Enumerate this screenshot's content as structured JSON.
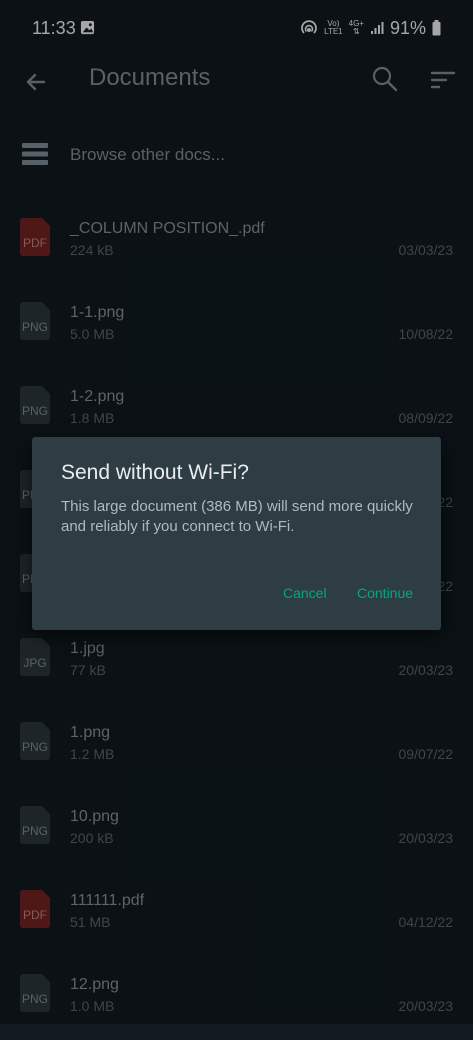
{
  "status_bar": {
    "time": "11:33",
    "network_volte": "Vo)",
    "network_lte": "LTE1",
    "network_4g": "4G+",
    "battery": "91%"
  },
  "app_bar": {
    "title": "Documents"
  },
  "browse": {
    "label": "Browse other docs..."
  },
  "files": [
    {
      "type_label": "PDF",
      "kind": "pdf",
      "name": "_COLUMN POSITION_.pdf",
      "size": "224 kB",
      "date": "03/03/23"
    },
    {
      "type_label": "PNG",
      "kind": "image",
      "name": "1-1.png",
      "size": "5.0 MB",
      "date": "10/08/22"
    },
    {
      "type_label": "PNG",
      "kind": "image",
      "name": "1-2.png",
      "size": "1.8 MB",
      "date": "08/09/22"
    },
    {
      "type_label": "PNG",
      "kind": "image",
      "name": "",
      "size": "",
      "date": "22"
    },
    {
      "type_label": "PNG",
      "kind": "image",
      "name": "",
      "size": "",
      "date": "22"
    },
    {
      "type_label": "JPG",
      "kind": "image",
      "name": "1.jpg",
      "size": "77 kB",
      "date": "20/03/23"
    },
    {
      "type_label": "PNG",
      "kind": "image",
      "name": "1.png",
      "size": "1.2 MB",
      "date": "09/07/22"
    },
    {
      "type_label": "PNG",
      "kind": "image",
      "name": "10.png",
      "size": "200 kB",
      "date": "20/03/23"
    },
    {
      "type_label": "PDF",
      "kind": "pdf",
      "name": "111111.pdf",
      "size": "51 MB",
      "date": "04/12/22"
    },
    {
      "type_label": "PNG",
      "kind": "image",
      "name": "12.png",
      "size": "1.0 MB",
      "date": "20/03/23"
    }
  ],
  "dialog": {
    "title": "Send without Wi-Fi?",
    "body": "This large document (386 MB) will send more quickly and reliably if you connect to Wi-Fi.",
    "cancel_label": "Cancel",
    "continue_label": "Continue"
  },
  "colors": {
    "background": "#111b21",
    "dialog": "#2e3c44",
    "accent": "#00a884",
    "pdf_icon": "#7b2424",
    "file_icon": "#2f3a40"
  }
}
